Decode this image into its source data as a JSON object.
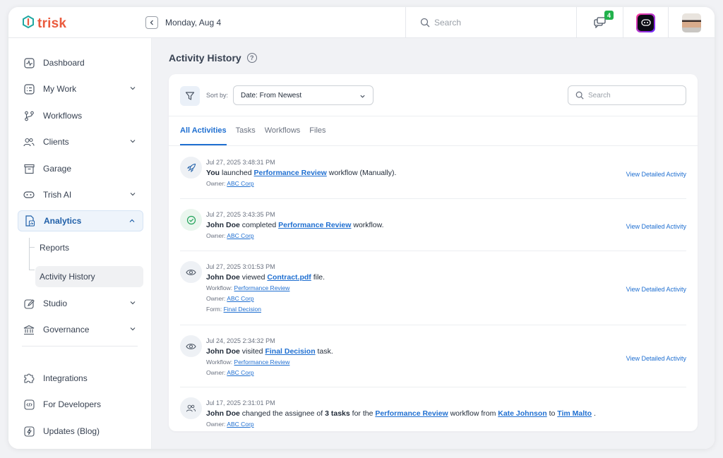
{
  "brand": {
    "name": "trisk",
    "color": "#ea5a3d"
  },
  "header": {
    "date": "Monday, Aug 4",
    "search_placeholder": "Search",
    "notifications_count": "4"
  },
  "sidebar": {
    "items": [
      {
        "label": "Dashboard",
        "icon": "dashboard-icon"
      },
      {
        "label": "My Work",
        "icon": "my-work-icon"
      },
      {
        "label": "Workflows",
        "icon": "workflows-icon"
      },
      {
        "label": "Clients",
        "icon": "clients-icon"
      },
      {
        "label": "Garage",
        "icon": "garage-icon"
      },
      {
        "label": "Trish AI",
        "icon": "trish-ai-icon"
      },
      {
        "label": "Analytics",
        "icon": "analytics-icon"
      },
      {
        "label": "Studio",
        "icon": "studio-icon"
      },
      {
        "label": "Governance",
        "icon": "governance-icon"
      },
      {
        "label": "Integrations",
        "icon": "integrations-icon"
      },
      {
        "label": "For Developers",
        "icon": "developers-icon"
      },
      {
        "label": "Updates (Blog)",
        "icon": "updates-icon"
      }
    ],
    "sub_items": [
      {
        "label": "Reports"
      },
      {
        "label": "Activity History"
      }
    ]
  },
  "page": {
    "title": "Activity History",
    "sort_label": "Sort by:",
    "sort_value": "Date: From Newest",
    "search_placeholder": "Search",
    "tabs": [
      {
        "label": "All Activities"
      },
      {
        "label": "Tasks"
      },
      {
        "label": "Workflows"
      },
      {
        "label": "Files"
      }
    ],
    "view_label": "View Detailed Activity"
  },
  "activities": [
    {
      "time": "Jul 27, 2025 3:48:31 PM",
      "actor": "You",
      "text1": " launched ",
      "link1": "Performance Review",
      "text2": " workflow (Manually).",
      "owner_label": "Owner: ",
      "owner": "ABC Corp"
    },
    {
      "time": "Jul 27, 2025 3:43:35 PM",
      "actor": "John Doe",
      "text1": " completed ",
      "link1": "Performance Review",
      "text2": " workflow.",
      "owner_label": "Owner: ",
      "owner": "ABC Corp"
    },
    {
      "time": "Jul 27, 2025 3:01:53 PM",
      "actor": "John Doe",
      "text1": " viewed ",
      "link1": "Contract.pdf",
      "text2": " file.",
      "workflow_label": "Workflow: ",
      "workflow": "Performance Review",
      "owner_label": "Owner: ",
      "owner": "ABC Corp",
      "form_label": "Form: ",
      "form": "Final Decision"
    },
    {
      "time": "Jul 24, 2025 2:34:32 PM",
      "actor": "John Doe",
      "text1": " visited ",
      "link1": "Final Decision",
      "text2": " task.",
      "workflow_label": "Workflow: ",
      "workflow": "Performance Review",
      "owner_label": "Owner: ",
      "owner": "ABC Corp"
    },
    {
      "time": "Jul 17, 2025 2:31:01 PM",
      "actor": "John Doe",
      "text1": " changed the assignee of ",
      "bold1": "3 tasks",
      "text2": " for the ",
      "link1": "Performance Review",
      "text3": " workflow from ",
      "link2": "Kate Johnson",
      "text4": " to ",
      "link3": "Tim Malto",
      "text5": " .",
      "owner_label": "Owner: ",
      "owner": "ABC Corp"
    }
  ]
}
